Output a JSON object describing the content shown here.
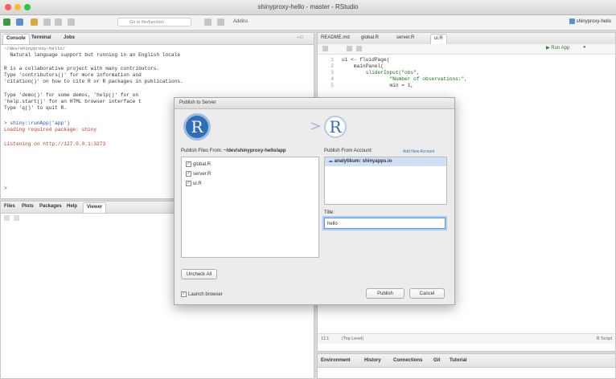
{
  "window": {
    "title": "shinyproxy-hello - master - RStudio"
  },
  "toolbar": {
    "goto_placeholder": "Go to file/function",
    "addins_label": "Addins",
    "project_label": "shinyproxy-hello"
  },
  "console_pane": {
    "tabs": [
      "Console",
      "Terminal",
      "Jobs"
    ],
    "path": "~/dev/shinyproxy-hello/",
    "lines": [
      "  Natural language support but running in an English locale",
      "",
      "R is a collaborative project with many contributors.",
      "Type 'contributors()' for more information and",
      "'citation()' on how to cite R or R packages in publications.",
      "",
      "Type 'demo()' for some demos, 'help()' for on",
      "'help.start()' for an HTML browser interface t",
      "Type 'q()' to quit R.",
      ""
    ],
    "command": "> shiny::runApp('app')",
    "loading": "Loading required package: shiny",
    "listening": "Listening on http://127.0.0.1:3273",
    "prompt": ">"
  },
  "files_pane": {
    "tabs": [
      "Files",
      "Plots",
      "Packages",
      "Help",
      "Viewer"
    ]
  },
  "editor": {
    "tabs": [
      "README.md",
      "global.R",
      "server.R",
      "ui.R"
    ],
    "run_label": "Run App",
    "line_numbers": [
      "1",
      "2",
      "3",
      "4",
      "5"
    ],
    "code_lines": [
      "ui <- fluidPage(",
      "    mainPanel(",
      "        sliderInput(\"obs\",",
      "                \"Number of observations:\",",
      "                min = 1,"
    ],
    "status_pos": "11:1",
    "status_level": "(Top Level)",
    "status_type": "R Script"
  },
  "env_pane": {
    "tabs": [
      "Environment",
      "History",
      "Connections",
      "Git",
      "Tutorial"
    ]
  },
  "dialog": {
    "title": "Publish to Server",
    "files_label": "Publish Files From:",
    "files_path": "~/dev/shinyproxy-hello/app",
    "files": [
      "global.R",
      "server.R",
      "ui.R"
    ],
    "account_label": "Publish From Account:",
    "add_account": "Add New Account",
    "account": "analytikum: shinyapps.io",
    "title_label": "Title:",
    "title_value": "hello",
    "uncheck_all": "Uncheck All",
    "launch_browser": "Launch browser",
    "publish": "Publish",
    "cancel": "Cancel"
  },
  "colors": {
    "r_blue": "#2f6fb6",
    "console_blue": "#2b4fa8",
    "console_red": "#c0392b",
    "selected_row": "#cfe0f7"
  }
}
